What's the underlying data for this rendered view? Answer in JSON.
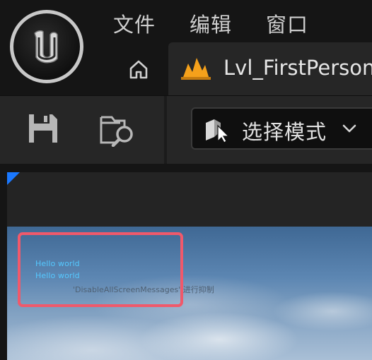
{
  "menu": {
    "items": [
      "文件",
      "编辑",
      "窗口"
    ]
  },
  "tabs": {
    "home_icon": "home-icon",
    "level_tab_label": "Lvl_FirstPerson"
  },
  "toolbar": {
    "save_icon": "save-icon",
    "browse_icon": "folder-search-icon",
    "mode_label": "选择模式"
  },
  "viewport": {
    "messages": [
      "Hello world",
      "Hello world"
    ],
    "suppressed_note": "'DisableAllScreenMessages' 进行抑制"
  },
  "colors": {
    "message_text": "#55c8ff",
    "highlight_border": "#f0596b",
    "level_icon": "#f5a11b"
  }
}
